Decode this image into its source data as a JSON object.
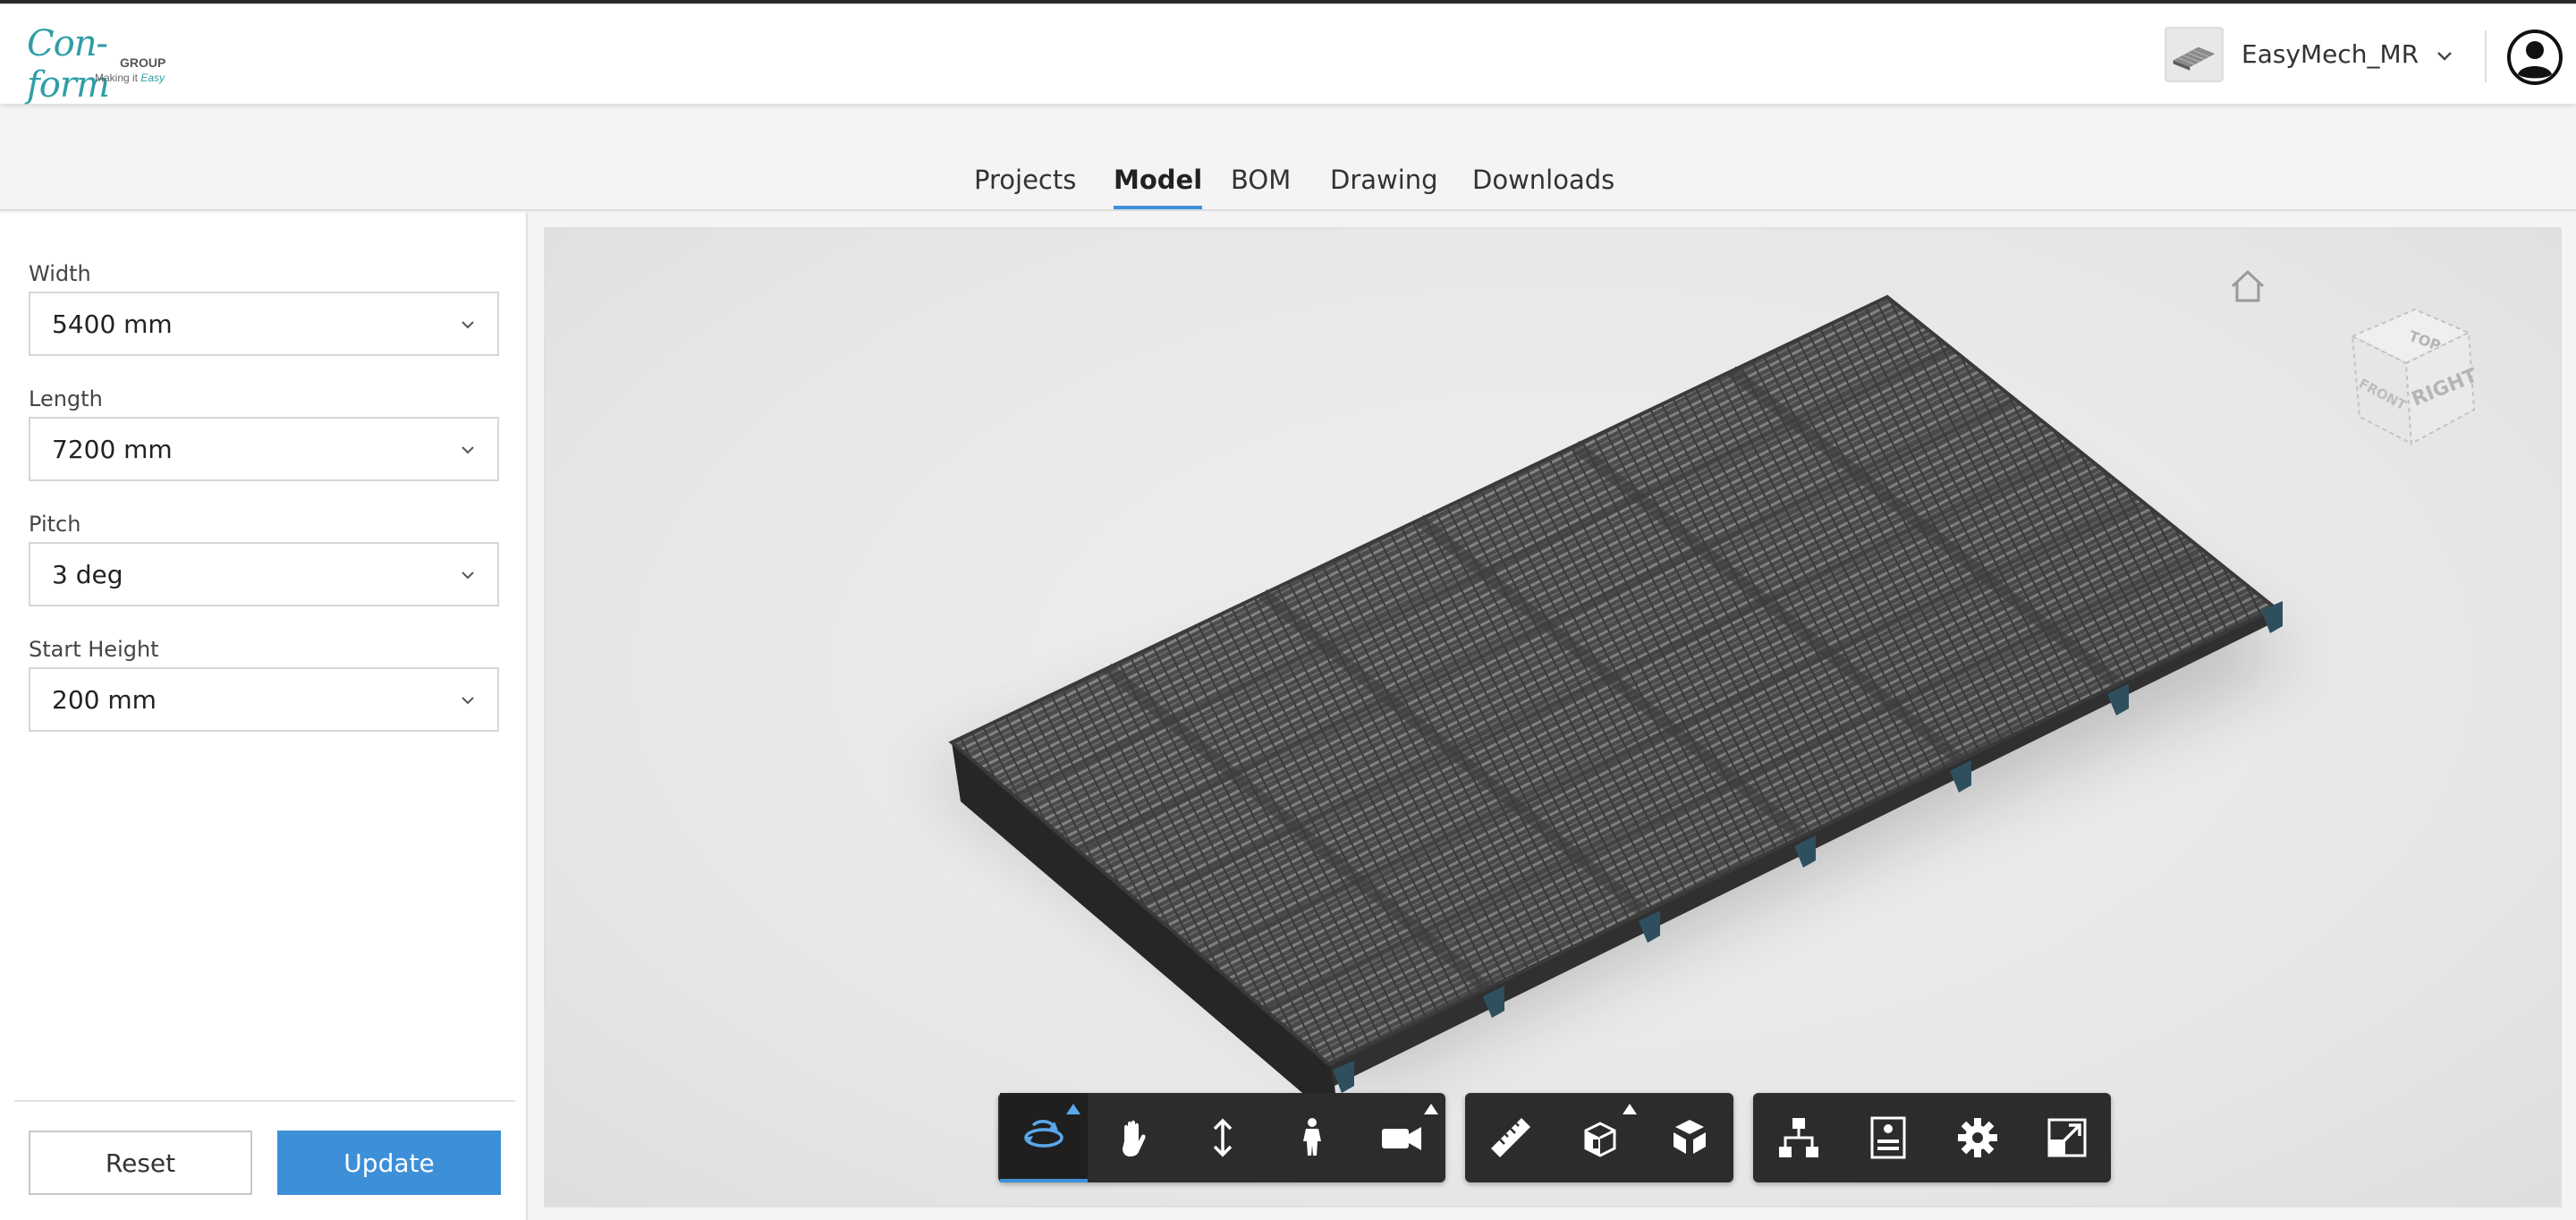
{
  "brand": {
    "logo_main": "Con-form",
    "logo_group": "GROUP",
    "logo_tag_prefix": "Making it ",
    "logo_tag_emph": "Easy"
  },
  "header": {
    "project_name": "EasyMech_MR",
    "project_thumbnail_icon": "platform-thumbnail-icon",
    "chevron_icon": "chevron-down-icon",
    "user_icon": "user-account-icon"
  },
  "tabs": [
    {
      "label": "Projects",
      "active": false
    },
    {
      "label": "Model",
      "active": true
    },
    {
      "label": "BOM",
      "active": false
    },
    {
      "label": "Drawing",
      "active": false
    },
    {
      "label": "Downloads",
      "active": false
    }
  ],
  "panel": {
    "fields": [
      {
        "label": "Width",
        "value": "5400 mm"
      },
      {
        "label": "Length",
        "value": "7200 mm"
      },
      {
        "label": "Pitch",
        "value": "3 deg"
      },
      {
        "label": "Start Height",
        "value": "200 mm"
      }
    ],
    "reset_label": "Reset",
    "update_label": "Update"
  },
  "viewer": {
    "home_icon": "home-icon",
    "viewcube_faces": {
      "top": "TOP",
      "front": "FRONT",
      "right": "RIGHT"
    },
    "toolbar": {
      "navigation": [
        "orbit-icon",
        "pan-icon",
        "dolly-icon",
        "first-person-icon",
        "camera-icon"
      ],
      "tools": [
        "measure-icon",
        "section-icon",
        "explode-icon"
      ],
      "settings": [
        "model-browser-icon",
        "properties-icon",
        "settings-icon",
        "fullscreen-icon"
      ]
    }
  },
  "colors": {
    "accent": "#3d8fd8",
    "brand": "#2f9ea6",
    "toolbar": "#2c2c2c",
    "grating": "#5a5a5a",
    "feet": "#2e4f5e"
  }
}
